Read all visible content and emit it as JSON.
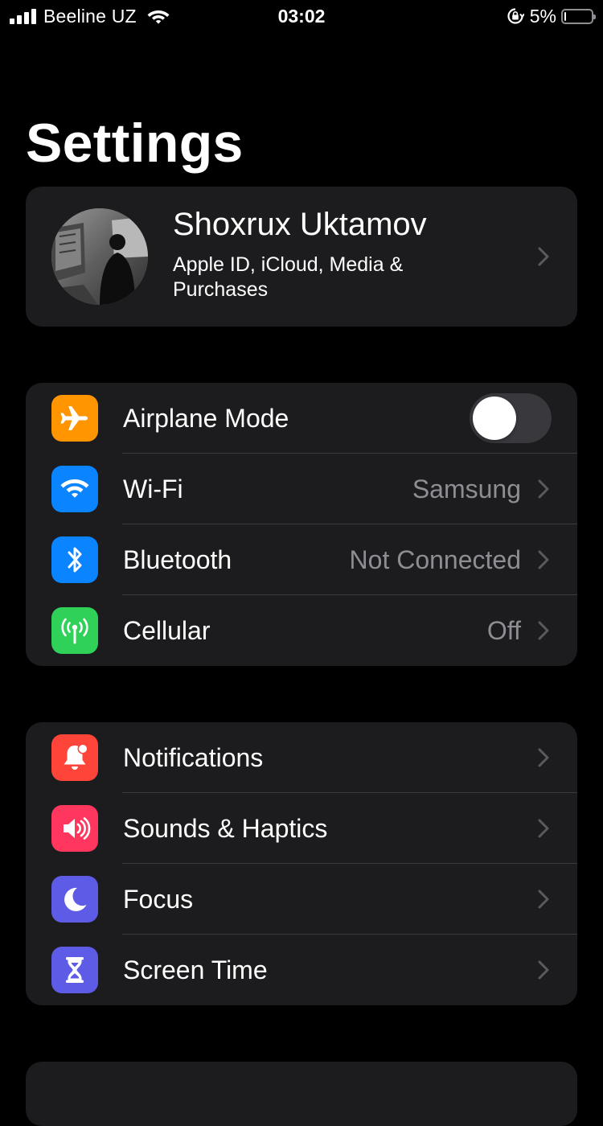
{
  "status_bar": {
    "carrier": "Beeline UZ",
    "time": "03:02",
    "battery_percent_label": "5%",
    "battery_level": 0.05,
    "icons": [
      "cellular-signal-icon",
      "wifi-icon",
      "rotation-lock-icon",
      "battery-icon"
    ]
  },
  "page": {
    "title": "Settings"
  },
  "profile": {
    "name": "Shoxrux Uktamov",
    "subtitle": "Apple ID, iCloud, Media & Purchases"
  },
  "connectivity": {
    "rows": [
      {
        "label": "Airplane Mode",
        "value": "",
        "icon": "airplane-icon",
        "icon_color": "#ff9500",
        "toggle": false
      },
      {
        "label": "Wi-Fi",
        "value": "Samsung",
        "icon": "wifi-icon",
        "icon_color": "#0a84ff"
      },
      {
        "label": "Bluetooth",
        "value": "Not Connected",
        "icon": "bluetooth-icon",
        "icon_color": "#0a84ff"
      },
      {
        "label": "Cellular",
        "value": "Off",
        "icon": "cellular-antenna-icon",
        "icon_color": "#30d158"
      }
    ]
  },
  "alerts": {
    "rows": [
      {
        "label": "Notifications",
        "icon": "bell-icon",
        "icon_color": "#ff453a"
      },
      {
        "label": "Sounds & Haptics",
        "icon": "speaker-icon",
        "icon_color": "#ff375f"
      },
      {
        "label": "Focus",
        "icon": "moon-icon",
        "icon_color": "#5e5ce6"
      },
      {
        "label": "Screen Time",
        "icon": "hourglass-icon",
        "icon_color": "#5e5ce6"
      }
    ]
  }
}
